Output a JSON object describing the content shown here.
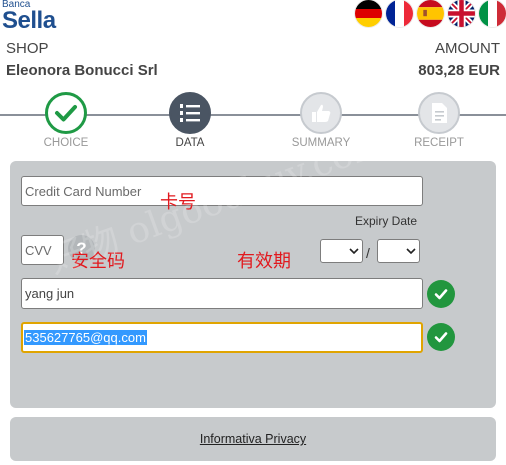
{
  "brand": {
    "small": "Banca",
    "name": "Sella"
  },
  "languages": [
    "german-flag",
    "french-flag",
    "spanish-flag",
    "uk-flag",
    "italian-flag"
  ],
  "merchant": {
    "shop_label": "SHOP",
    "shop_name": "Eleonora Bonucci Srl"
  },
  "payment": {
    "amount_label": "AMOUNT",
    "amount_value": "803,28 EUR"
  },
  "steps": [
    {
      "label": "CHOICE",
      "state": "done",
      "icon": "check-icon"
    },
    {
      "label": "DATA",
      "state": "active",
      "icon": "numbered-list-icon"
    },
    {
      "label": "SUMMARY",
      "state": "pending",
      "icon": "thumbs-up-icon"
    },
    {
      "label": "RECEIPT",
      "state": "pending",
      "icon": "document-icon"
    }
  ],
  "form": {
    "card_number_placeholder": "Credit Card Number",
    "expiry_label": "Expiry Date",
    "expiry_separator": "/",
    "cvv_placeholder": "CVV",
    "cvv_help": "?",
    "name_value": "yang jun",
    "email_value": "535627765@qq.com"
  },
  "annotations": {
    "card_number": "卡号",
    "cvv": "安全码",
    "expiry": "有效期"
  },
  "watermark": "好物 olgoodbuy.com",
  "footer": {
    "privacy_link": "Informativa Privacy"
  },
  "colors": {
    "brand_blue": "#1f4f8f",
    "success_green": "#22963e",
    "step_active": "#4a5563",
    "panel_gray": "#c7cacc",
    "focus_border": "#e0a400",
    "annotation_red": "#e1191e"
  }
}
